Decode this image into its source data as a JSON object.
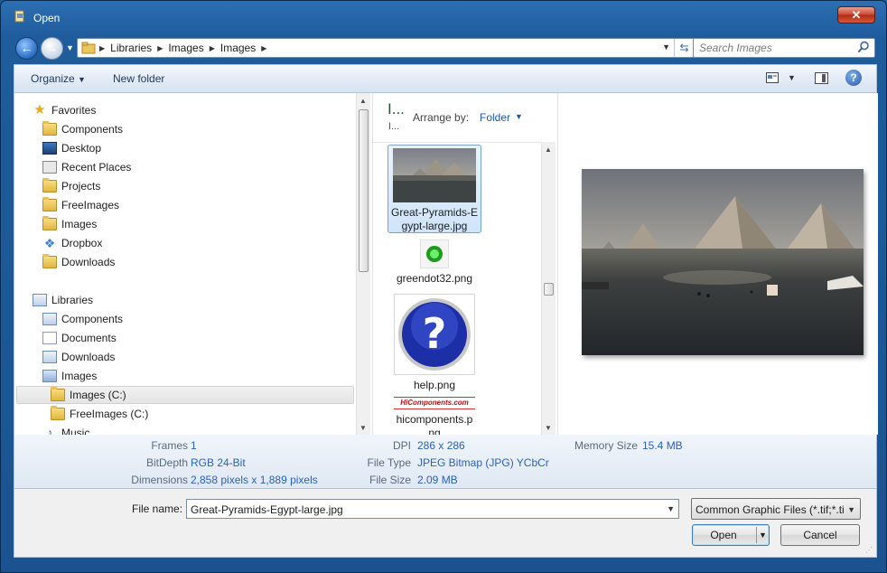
{
  "window": {
    "title": "Open",
    "close_label": "✕"
  },
  "nav": {
    "crumbs": [
      "Libraries",
      "Images",
      "Images"
    ],
    "search_placeholder": "Search Images"
  },
  "toolbar": {
    "organize_label": "Organize",
    "new_folder_label": "New folder",
    "help_label": "?"
  },
  "sidebar": {
    "favorites": {
      "label": "Favorites",
      "items": [
        "Components",
        "Desktop",
        "Recent Places",
        "Projects",
        "FreeImages",
        "Images",
        "Dropbox",
        "Downloads"
      ]
    },
    "libraries": {
      "label": "Libraries",
      "items": [
        "Components",
        "Documents",
        "Downloads",
        "Images"
      ],
      "subitems": [
        "Images (C:)",
        "FreeImages (C:)"
      ],
      "partial": "Music"
    }
  },
  "filepane": {
    "library_title": "I...",
    "library_sub": "I...",
    "arrange_label": "Arrange by:",
    "arrange_value": "Folder",
    "files": [
      {
        "name": "Great-Pyramids-Egypt-large.jpg",
        "line1": "Great-Pyramids-E",
        "line2": "gypt-large.jpg"
      },
      {
        "name": "greendot32.png"
      },
      {
        "name": "help.png"
      },
      {
        "name": "hicomponents.png",
        "line1": "hicomponents.p",
        "line2": "ng",
        "logo_text": "HiComponents.com"
      }
    ]
  },
  "details": {
    "frames_label": "Frames",
    "frames_value": "1",
    "bitdepth_label": "BitDepth",
    "bitdepth_value": "RGB 24-Bit",
    "dimensions_label": "Dimensions",
    "dimensions_value": "2,858 pixels x 1,889 pixels",
    "dpi_label": "DPI",
    "dpi_value": "286 x 286",
    "filetype_label": "File Type",
    "filetype_value": "JPEG Bitmap (JPG) YCbCr",
    "filesize_label": "File Size",
    "filesize_value": "2.09 MB",
    "memory_label": "Memory Size",
    "memory_value": "15.4 MB"
  },
  "bottom": {
    "filename_label": "File name:",
    "filename_value": "Great-Pyramids-Egypt-large.jpg",
    "filter_value": "Common Graphic Files (*.tif;*.ti",
    "open_label": "Open",
    "cancel_label": "Cancel"
  },
  "colors": {
    "accent": "#2a63b8",
    "title_bar": "#1f5c9c",
    "library_title": "#1e5a2c"
  }
}
